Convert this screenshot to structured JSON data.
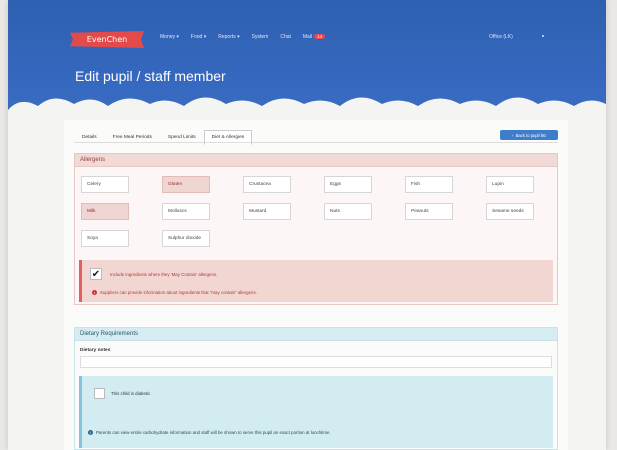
{
  "brand": "EvenChen",
  "nav": [
    "Money",
    "Food",
    "Reports",
    "System",
    "Chat",
    "Mail"
  ],
  "mail_badge": "14",
  "office": "Office (LK)",
  "page_title": "Edit pupil / staff member",
  "tabs": [
    "Details",
    "Free Meal Periods",
    "Spend Limits",
    "Diet & Allergies"
  ],
  "active_tab": 3,
  "back_button": "Back to pupil list",
  "allergens": {
    "title": "Allergens",
    "items": [
      {
        "label": "Celery",
        "selected": false
      },
      {
        "label": "Gluten",
        "selected": true
      },
      {
        "label": "Crustacea",
        "selected": false
      },
      {
        "label": "Eggs",
        "selected": false
      },
      {
        "label": "Fish",
        "selected": false
      },
      {
        "label": "Lupin",
        "selected": false
      },
      {
        "label": "Milk",
        "selected": true
      },
      {
        "label": "Molluscs",
        "selected": false
      },
      {
        "label": "Mustard",
        "selected": false
      },
      {
        "label": "Nuts",
        "selected": false
      },
      {
        "label": "Peanuts",
        "selected": false
      },
      {
        "label": "Sesame seeds",
        "selected": false
      },
      {
        "label": "Soya",
        "selected": false
      },
      {
        "label": "Sulphur dioxide",
        "selected": false
      }
    ],
    "may_contain_label": "Include ingredients where they 'May Contain' allergens.",
    "may_contain_info": "Suppliers can provide information about ingredients that \"may contain\" allergens."
  },
  "dietary": {
    "title": "Dietary Requirements",
    "notes_label": "Dietary notes",
    "notes_value": "",
    "diabetic_label": "This child is diabetic",
    "diabetic_info": "Parents can view entire carbohydrate information and staff will be shown to serve this pupil an exact portion at lunchtime."
  },
  "colors": {
    "header": "#3467bd",
    "allergen_panel": "#f1d9d6",
    "dietary_panel": "#d5ecf2",
    "button": "#3d7dca"
  }
}
